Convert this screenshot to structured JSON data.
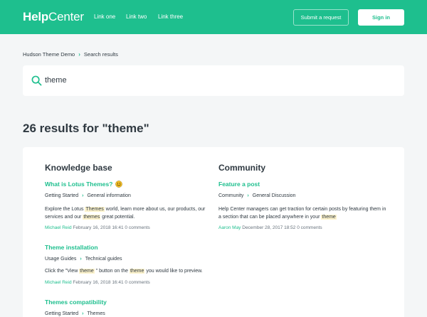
{
  "header": {
    "logo_bold": "Help",
    "logo_light": "Center",
    "nav": [
      "Link one",
      "Link two",
      "Link three"
    ],
    "submit_label": "Submit a request",
    "signin_label": "Sign in",
    "brand_color": "#1ebf8e"
  },
  "breadcrumb": {
    "items": [
      "Hudson Theme Demo",
      "Search results"
    ]
  },
  "search": {
    "value": "theme",
    "icon": "search-icon"
  },
  "results_heading": "26 results for \"theme\"",
  "knowledge_base": {
    "title": "Knowledge base",
    "results": [
      {
        "title": "What is Lotus Themes?",
        "crumbs": [
          "Getting Started",
          "General information"
        ],
        "excerpt_parts": [
          "Explore the Lotus ",
          "Themes",
          " world, learn more about us, our products, our services and our ",
          "themes",
          " great potential."
        ],
        "author": "Michael Reid",
        "date": "February 16, 2018 16:41",
        "comments": "0 comments"
      },
      {
        "title": "Theme installation",
        "crumbs": [
          "Usage Guides",
          "Technical guides"
        ],
        "excerpt_parts": [
          "Click the \"View ",
          "theme",
          " \" button on the ",
          "theme",
          " you would like to preview."
        ],
        "author": "Michael Reid",
        "date": "February 16, 2018 16:41",
        "comments": "0 comments"
      },
      {
        "title": "Themes compatibility",
        "crumbs": [
          "Getting Started",
          "Themes"
        ]
      }
    ]
  },
  "community": {
    "title": "Community",
    "results": [
      {
        "title": "Feature a post",
        "crumbs": [
          "Community",
          "General Discussion"
        ],
        "excerpt_parts": [
          "Help Center managers can get traction for certain posts by featuring them in a section that can be placed anywhere in your ",
          "theme"
        ],
        "author": "Aaron May",
        "date": "December 28, 2017 18:52",
        "comments": "0 comments"
      }
    ]
  }
}
